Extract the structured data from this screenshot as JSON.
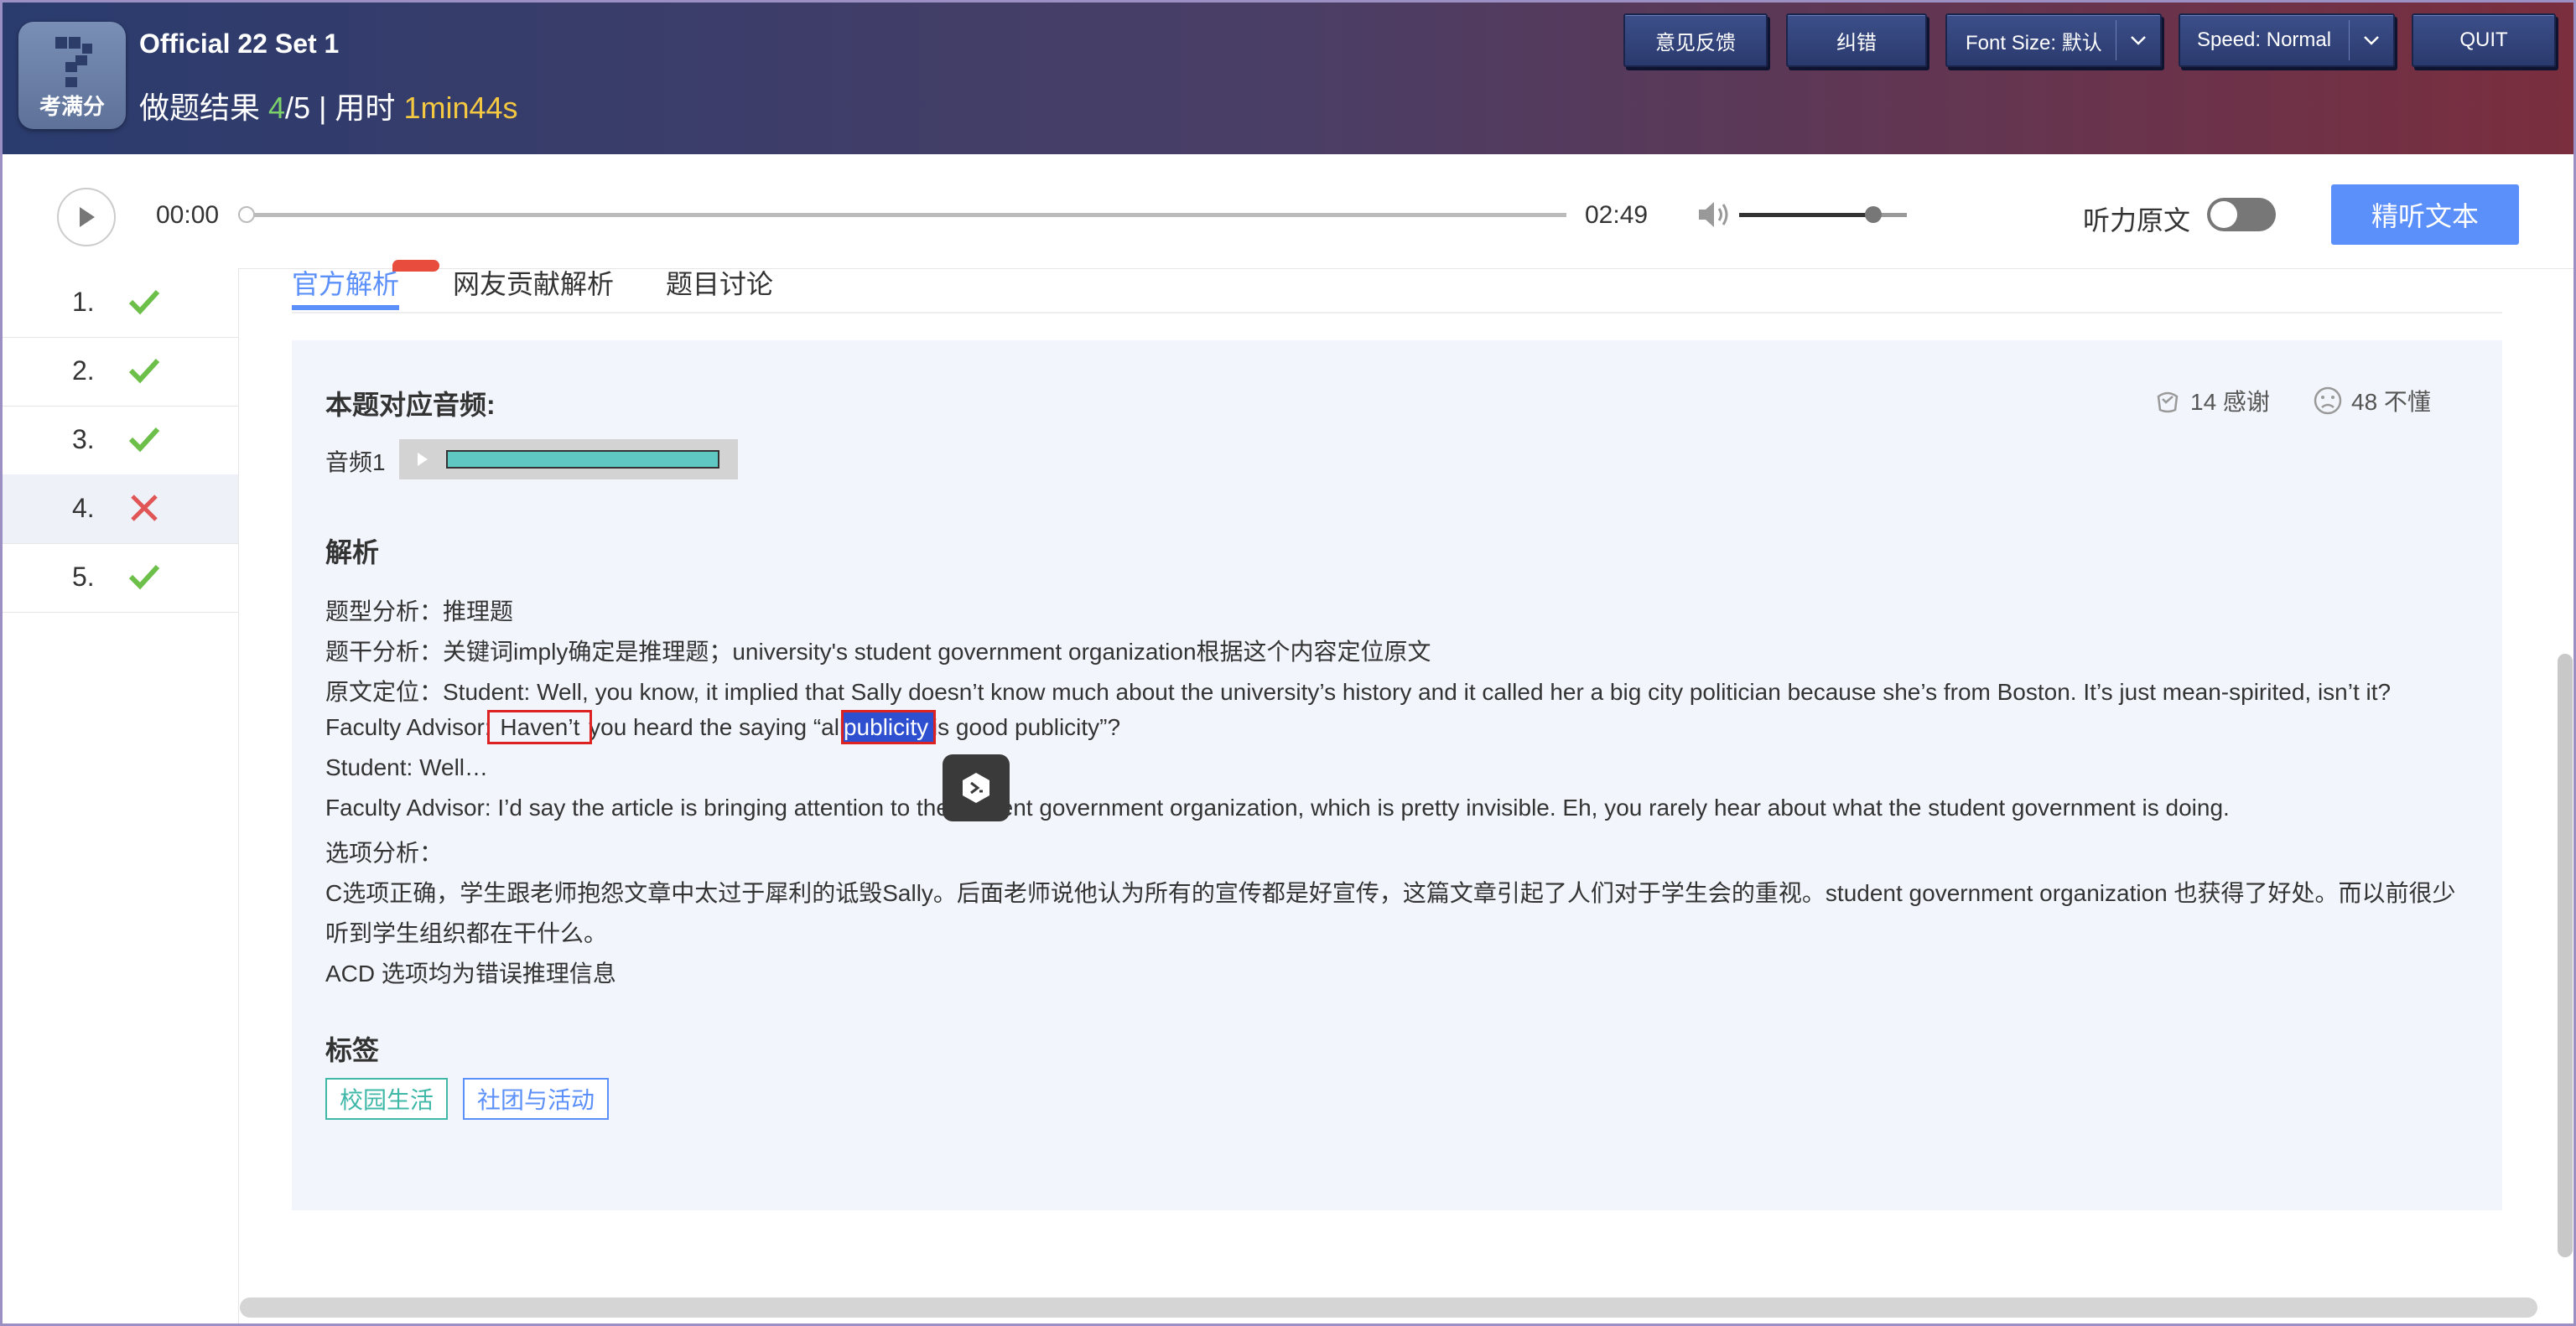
{
  "header": {
    "logo_text": "考满分",
    "title": "Official 22 Set 1",
    "result_prefix": "做题结果 ",
    "result_correct": "4",
    "result_total": "/5",
    "result_sep": " | 用时 ",
    "result_time": "1min44s",
    "buttons": {
      "feedback": "意见反馈",
      "correction": "纠错",
      "font_size": "Font Size: 默认",
      "speed": "Speed: Normal",
      "quit": "QUIT"
    }
  },
  "player": {
    "current_time": "00:00",
    "total_time": "02:49",
    "progress": 0,
    "volume": 0.8,
    "original_text_label": "听力原文",
    "original_text_on": false,
    "listen_button": "精听文本"
  },
  "sidebar": {
    "questions": [
      {
        "num": "1.",
        "status": "correct"
      },
      {
        "num": "2.",
        "status": "correct"
      },
      {
        "num": "3.",
        "status": "correct"
      },
      {
        "num": "4.",
        "status": "wrong",
        "active": true
      },
      {
        "num": "5.",
        "status": "correct"
      }
    ]
  },
  "tabs": [
    "官方解析",
    "网友贡献解析",
    "题目讨论"
  ],
  "panel": {
    "audio_heading": "本题对应音频:",
    "thanks": "14 感谢",
    "confused": "48 不懂",
    "audio_label": "音频1",
    "analysis_heading": "解析",
    "lines": {
      "l1": "题型分析：推理题",
      "l2": "题干分析：关键词imply确定是推理题；university's student government organization根据这个内容定位原文",
      "l3": "原文定位：Student: Well, you know, it implied that Sally doesn’t know much about the university’s history and it called her a big city politician because she’s from Boston. It’s just mean-spirited, isn’t it?",
      "l4a": "Faculty Advisor: ",
      "l4b": "Haven’t",
      "l4c": " you heard the saying “all ",
      "l4d": "publicity",
      "l4e": " is good publicity”?",
      "l5": "Student: Well…",
      "l6": "Faculty Advisor: I’d say the article is bringing attention to the student government organization, which is pretty invisible. Eh, you rarely hear about what the student government is doing.",
      "l7": "选项分析：",
      "l8": "C选项正确，学生跟老师抱怨文章中太过于犀利的诋毁Sally。后面老师说他认为所有的宣传都是好宣传，这篇文章引起了人们对于学生会的重视。student government organization 也获得了好处。而以前很少",
      "l9": "听到学生组织都在干什么。",
      "l10": "ACD 选项均为错误推理信息"
    },
    "tags_heading": "标签",
    "tags": [
      "校园生活",
      "社团与活动"
    ]
  },
  "colors": {
    "accent": "#5b8ff9",
    "correct": "#6cc04a",
    "wrong": "#e05555"
  }
}
